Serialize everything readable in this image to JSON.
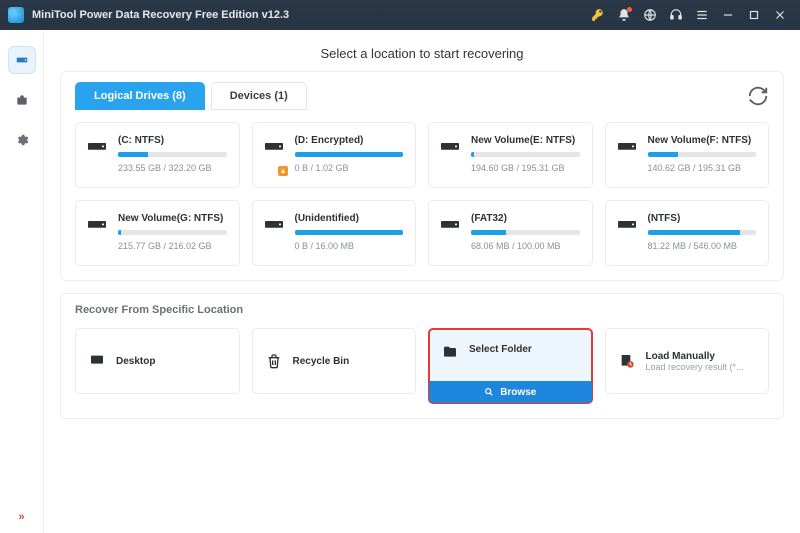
{
  "app": {
    "title": "MiniTool Power Data Recovery Free Edition v12.3"
  },
  "headline": "Select a location to start recovering",
  "tabs": {
    "logical": "Logical Drives (8)",
    "devices": "Devices (1)"
  },
  "drives": [
    {
      "title": "(C: NTFS)",
      "sub": "233.55 GB / 323.20 GB",
      "fill": 28,
      "locked": false
    },
    {
      "title": "(D: Encrypted)",
      "sub": "0 B / 1.02 GB",
      "fill": 100,
      "locked": true
    },
    {
      "title": "New Volume(E: NTFS)",
      "sub": "194.60 GB / 195.31 GB",
      "fill": 3,
      "locked": false
    },
    {
      "title": "New Volume(F: NTFS)",
      "sub": "140.62 GB / 195.31 GB",
      "fill": 28,
      "locked": false
    },
    {
      "title": "New Volume(G: NTFS)",
      "sub": "215.77 GB / 216.02 GB",
      "fill": 3,
      "locked": false
    },
    {
      "title": "(Unidentified)",
      "sub": "0 B / 16.00 MB",
      "fill": 100,
      "locked": false
    },
    {
      "title": "(FAT32)",
      "sub": "68.06 MB / 100.00 MB",
      "fill": 32,
      "locked": false
    },
    {
      "title": "(NTFS)",
      "sub": "81.22 MB / 546.00 MB",
      "fill": 85,
      "locked": false
    }
  ],
  "section": {
    "title": "Recover From Specific Location"
  },
  "locations": {
    "desktop": "Desktop",
    "recycle": "Recycle Bin",
    "select": "Select Folder",
    "browse": "Browse",
    "loadManually": "Load Manually",
    "loadSub": "Load recovery result (*..."
  }
}
